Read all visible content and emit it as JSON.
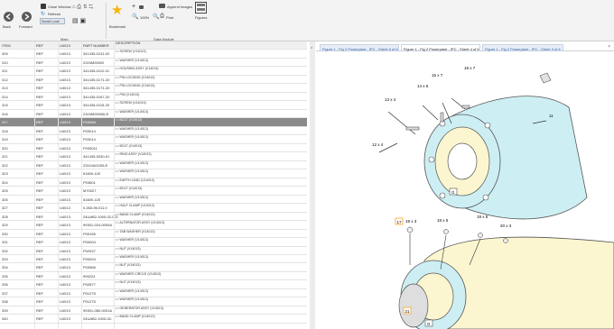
{
  "ribbon": {
    "back": "Back",
    "forward": "Forward",
    "close_window": "Close Window",
    "refresh": "Refresh",
    "scroll_lock": "Scroll Lock",
    "main_group": "Main",
    "bookmark": "Bookmark",
    "zoom": "100%",
    "print": "Print",
    "append_images": "Append Images",
    "figures": "Figures",
    "data_module_group": "Data Module"
  },
  "tabs": [
    "Figure 1 - Fig 2 Powerplant - IPC - Sheet 6 of 6",
    "Figure 1 - Fig 2 Powerplant - IPC - Sheet 4 of 6",
    "Figure 1 - Fig 2 Powerplant - IPC - Sheet 3 of 6"
  ],
  "headers": [
    "ITEM",
    "REF",
    "U4013",
    "PART NUMBER",
    "DESCRIPTION"
  ],
  "rows": [
    [
      "309",
      "REF",
      "U4013",
      "341435-0131-02",
      "• • SCREW (V14013)"
    ],
    [
      "310",
      "REF",
      "U4013",
      "2315M00002",
      "• • WASHER (V14013)"
    ],
    [
      "311",
      "REF",
      "U4013",
      "341435-0112-01",
      "• • HOUSING ASSY (V14013)"
    ],
    [
      "312",
      "REF",
      "U4013",
      "341435-0171-20",
      "• • PIN LOCKING (V14013)"
    ],
    [
      "313",
      "REF",
      "U4013",
      "341435-0171-20",
      "• • PIN LOCKING (V14013)"
    ],
    [
      "314",
      "REF",
      "U4013",
      "341435-0167-20",
      "• • PIN (V14013)"
    ],
    [
      "315",
      "REF",
      "U4013",
      "341435-0115-20",
      "• • SCREW (V14013)"
    ],
    [
      "316",
      "REF",
      "U4013",
      "2315M00006LE",
      "• • WASHER (V14013)"
    ],
    [
      "317",
      "REF",
      "U4013",
      "P03966",
      "• • BOLT (V14013)"
    ],
    [
      "318",
      "REF",
      "U4013",
      "P03014",
      "• • WASHER (V14013)"
    ],
    [
      "319",
      "REF",
      "U4013",
      "P03014",
      "• • WASHER (V14013)"
    ],
    [
      "320",
      "REF",
      "U4013",
      "P035011",
      "• • BOLT (V14013)"
    ],
    [
      "321",
      "REF",
      "U4013",
      "341435-0030-01",
      "• • RING ASSY (V14013)"
    ],
    [
      "322",
      "REF",
      "U4013",
      "23110A0100LE",
      "• • WASHER (V14013)"
    ],
    [
      "323",
      "REF",
      "U4013",
      "61600-11E",
      "• • WASHER (V14013)"
    ],
    [
      "324",
      "REF",
      "U4013",
      "P03601",
      "• • EARTH LEAD (V14013)"
    ],
    [
      "325",
      "REF",
      "U4013",
      "M70027",
      "• • BOLT (V14013)"
    ],
    [
      "326",
      "REF",
      "U4013",
      "61600-11E",
      "• • WASHER (V14013)"
    ],
    [
      "327",
      "REF",
      "U4013",
      "0.265-96.011.0",
      "• • HALF CLAMP (V14013)"
    ],
    [
      "328",
      "REF",
      "U4013",
      "24UAB2-1000-02-001",
      "• • BAND CLAMP (V14013)"
    ],
    [
      "329",
      "REF",
      "U4013",
      "99301-024-0005A",
      "• • ALTERNATOR ASSY (V14013)"
    ],
    [
      "330",
      "REF",
      "U4013",
      "P05155",
      "• • TAB WASHER (V14013)"
    ],
    [
      "331",
      "REF",
      "U4013",
      "P00004",
      "• • WASHER (V14013)"
    ],
    [
      "332",
      "REF",
      "U4013",
      "P02937",
      "• • NUT (V14013)"
    ],
    [
      "333",
      "REF",
      "U4013",
      "P00004",
      "• • WASHER (V14013)"
    ],
    [
      "334",
      "REF",
      "U4013",
      "P03966",
      "• • NUT (V14013)"
    ],
    [
      "335",
      "REF",
      "U4013",
      "905224",
      "• • WASHER CIRCLE (V14013)"
    ],
    [
      "336",
      "REF",
      "U4013",
      "P02877",
      "• • NUT (V14013)"
    ],
    [
      "337",
      "REF",
      "U4013",
      "P01275",
      "• • WASHER (V14013)"
    ],
    [
      "338",
      "REF",
      "U4013",
      "P01275",
      "• • WASHER (V14013)"
    ],
    [
      "339",
      "REF",
      "U4013",
      "99301-080-0001A",
      "• • GENERATOR ASSY (V14013)"
    ],
    [
      "340",
      "REF",
      "U4013",
      "24UAB2-1000-02-",
      "• • BAND CLAMP (V14013)"
    ]
  ],
  "selected_index": 8,
  "callouts": {
    "a": "18 x 7",
    "b": "15 x 7",
    "c": "14 x 6",
    "d": "13 x 4",
    "e": "11",
    "f": "12 x 4",
    "g1": "G",
    "h": "17",
    "i": "19 x 3",
    "j": "18 x 5",
    "k": "19 x 5",
    "l": "20 x 3",
    "m": "21",
    "g2": "G"
  },
  "colors": {
    "cyan_part": "#cdeff4",
    "yellow_part": "#fbf6cf",
    "highlight": "#f5a623"
  }
}
